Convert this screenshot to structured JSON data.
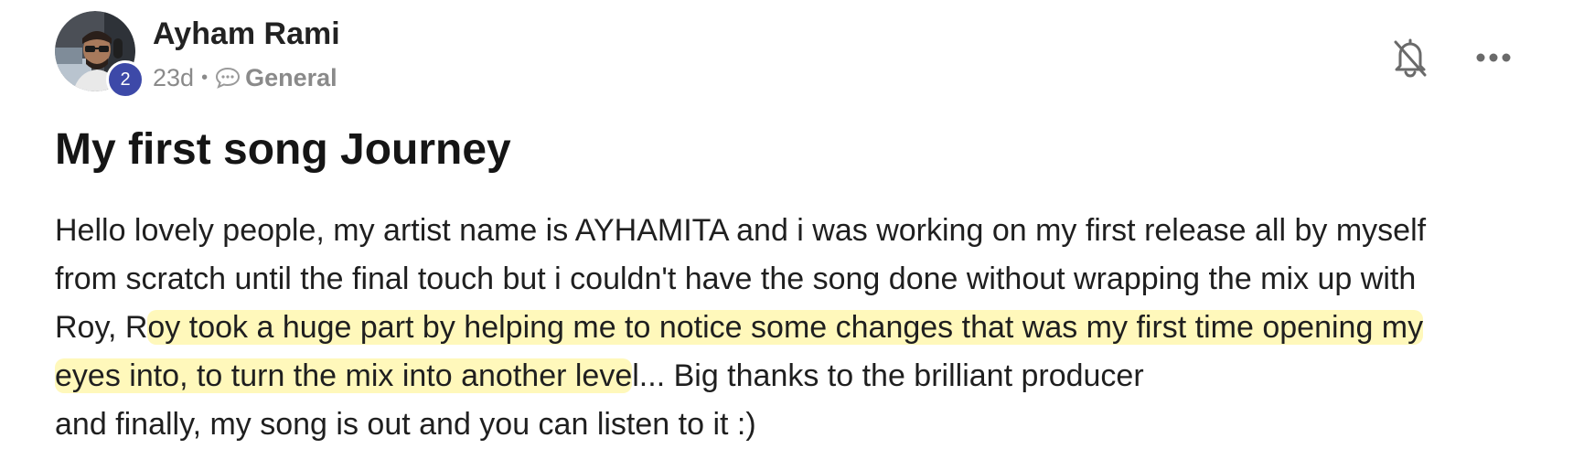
{
  "post": {
    "author": {
      "name": "Ayham Rami",
      "level": "2",
      "avatar_icon": "user-avatar-photo"
    },
    "meta": {
      "age": "23d",
      "separator": "•",
      "category_icon": "chat-bubble-icon",
      "category": "General"
    },
    "actions": {
      "notifications_icon": "bell-off-icon",
      "more_icon": "more-horizontal-icon"
    },
    "title": "My first song Journey",
    "body": {
      "line1": "Hello lovely people, my artist name is AYHAMITA and i was working on my first release all by myself",
      "line2": "from scratch until the final touch but i couldn't have the song done without wrapping the mix up with",
      "line3_plain": "Roy, R",
      "line3_highlight": "oy took a huge part by helping me to notice some changes that was my first time opening my",
      "line4_highlight": "eyes into, to turn the mix into another leve",
      "line4_plain": "l... Big thanks to the brilliant producer",
      "line5": "and finally, my song is out and you can listen to it :)"
    }
  },
  "colors": {
    "badge": "#3d49a8",
    "highlight": "#fff496",
    "meta_text": "#8a8a8a"
  }
}
